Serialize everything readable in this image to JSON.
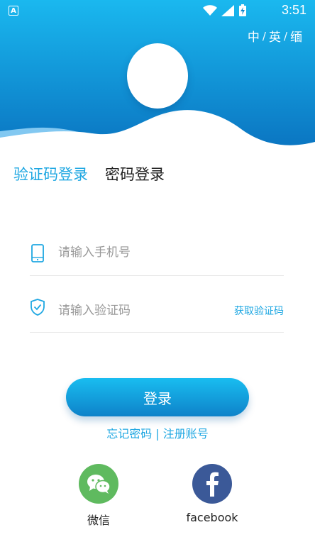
{
  "status_bar": {
    "time": "3:51",
    "app_icon_letter": "A"
  },
  "language": {
    "options": [
      "中",
      "英",
      "缅"
    ],
    "separator": "/"
  },
  "tabs": [
    {
      "label": "验证码登录",
      "active": true
    },
    {
      "label": "密码登录",
      "active": false
    }
  ],
  "form": {
    "phone_placeholder": "请输入手机号",
    "code_placeholder": "请输入验证码",
    "get_code_label": "获取验证码"
  },
  "login_button_label": "登录",
  "links": {
    "forgot": "忘记密码",
    "divider": "|",
    "register": "注册账号"
  },
  "social": [
    {
      "label": "微信",
      "icon": "wechat-icon",
      "color": "#5fba5f"
    },
    {
      "label": "facebook",
      "icon": "facebook-icon",
      "color": "#3b5998"
    }
  ],
  "colors": {
    "accent": "#1ea7e2",
    "header_top": "#1ab8ef",
    "header_bottom": "#0a73c0"
  }
}
